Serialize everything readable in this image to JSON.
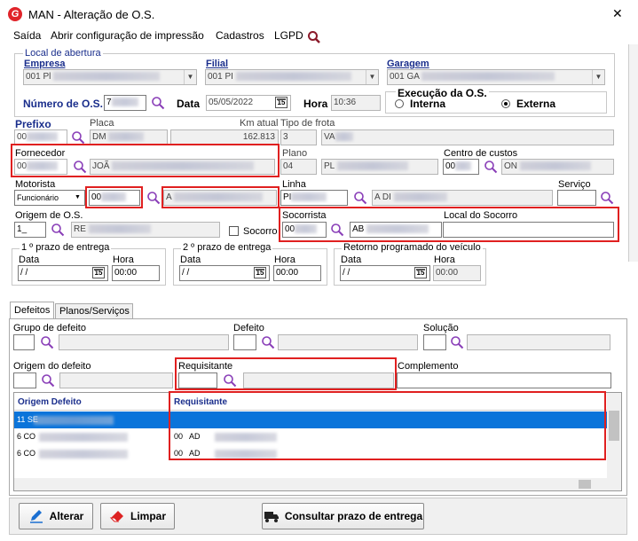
{
  "window": {
    "title": "MAN - Alteração de O.S.",
    "close": "✕"
  },
  "menu": {
    "items": [
      "Saída",
      "Abrir configuração de impressão",
      "Cadastros",
      "LGPD"
    ]
  },
  "abertura": {
    "legend": "Local de abertura",
    "empresa_label": "Empresa",
    "empresa_value": "001 Pl",
    "filial_label": "Filial",
    "filial_value": "001 PI",
    "garagem_label": "Garagem",
    "garagem_value": "001 GA"
  },
  "os": {
    "numero_label": "Número de O.S.",
    "numero_value": "7",
    "data_label": "Data",
    "data_value": "05/05/2022",
    "hora_label": "Hora",
    "hora_value": "10:36",
    "exec_legend": "Execução da O.S.",
    "interna": "Interna",
    "externa": "Externa",
    "exec_selected": "Externa"
  },
  "veiculo": {
    "prefixo_label": "Prefixo",
    "prefixo_value": "00",
    "placa_label": "Placa",
    "placa_value": "DM",
    "km_label": "Km atual",
    "km_value": "162.813",
    "tipo_label": "Tipo de frota",
    "tipo_code": "3",
    "tipo_desc": "VA"
  },
  "fornecedor": {
    "label": "Fornecedor",
    "code": "00",
    "desc": "JOÃ"
  },
  "plano": {
    "label": "Plano",
    "code": "04",
    "desc": "PL"
  },
  "centro": {
    "label": "Centro de custos",
    "code": "00",
    "desc": "ON"
  },
  "motorista": {
    "label": "Motorista",
    "select": "Funcionário",
    "code": "00",
    "desc": "A"
  },
  "linha": {
    "label": "Linha",
    "code": "PI",
    "desc": "A DI"
  },
  "servico": {
    "label": "Serviço"
  },
  "origem_os": {
    "label": "Origem de O.S.",
    "code": "1",
    "desc": "RE",
    "socorro_label": "Socorro"
  },
  "socorrista": {
    "label": "Socorrista",
    "code": "00",
    "desc": "AB",
    "local_label": "Local do Socorro"
  },
  "prazo1": {
    "legend": "1 º prazo de entrega",
    "data_label": "Data",
    "data_value": " / /",
    "hora_label": "Hora",
    "hora_value": "00:00"
  },
  "prazo2": {
    "legend": "2 º prazo de entrega",
    "data_label": "Data",
    "data_value": " / /",
    "hora_label": "Hora",
    "hora_value": "00:00"
  },
  "retorno": {
    "legend": "Retorno programado do veículo",
    "data_label": "Data",
    "data_value": " / /",
    "hora_label": "Hora",
    "hora_value": "00:00"
  },
  "tabs": [
    "Defeitos",
    "Planos/Serviços"
  ],
  "defeitos": {
    "grupo_label": "Grupo de defeito",
    "defeito_label": "Defeito",
    "solucao_label": "Solução",
    "origem_label": "Origem do defeito",
    "requisitante_label": "Requisitante",
    "complemento_label": "Complemento"
  },
  "grid": {
    "headers": [
      "Origem Defeito",
      "Requisitante"
    ],
    "rows": [
      {
        "origem": "11 SE",
        "req": ""
      },
      {
        "origem": "6 CO",
        "req": "00   AD"
      },
      {
        "origem": "6 CO",
        "req": "00   AD"
      }
    ]
  },
  "buttons": {
    "alterar": "Alterar",
    "limpar": "Limpar",
    "consultar": "Consultar prazo de entrega"
  },
  "calendar_glyph": "15",
  "colors": {
    "accent": "#1a2e8c",
    "highlight": "#e02020",
    "selection": "#0a74da"
  }
}
